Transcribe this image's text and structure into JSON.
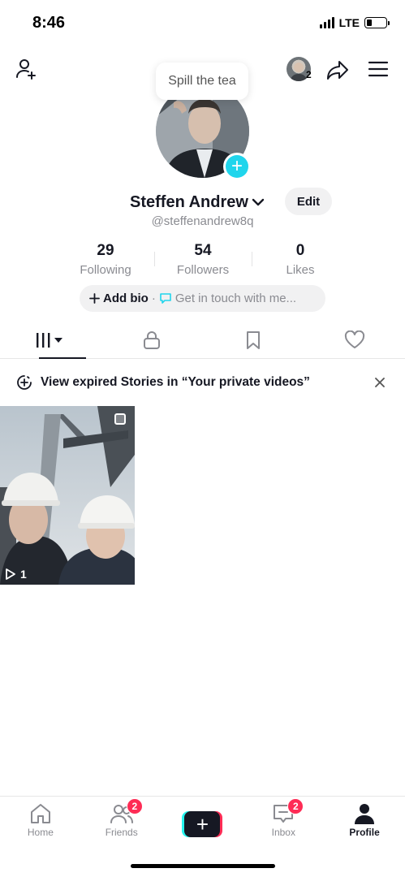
{
  "status_bar": {
    "time": "8:46",
    "network": "LTE"
  },
  "header": {
    "story_count": "2",
    "tooltip": "Spill the tea"
  },
  "profile": {
    "display_name": "Steffen Andrew",
    "username": "@steffenandrew8q",
    "edit_label": "Edit"
  },
  "stats": [
    {
      "value": "29",
      "label": "Following"
    },
    {
      "value": "54",
      "label": "Followers"
    },
    {
      "value": "0",
      "label": "Likes"
    }
  ],
  "bio": {
    "add_label": "Add bio",
    "separator": "·",
    "contact_label": "Get in touch with me..."
  },
  "banner": {
    "text": "View expired Stories in “Your private videos”"
  },
  "videos": [
    {
      "views": "1"
    }
  ],
  "bottom_nav": [
    {
      "label": "Home"
    },
    {
      "label": "Friends",
      "badge": "2"
    },
    {
      "label": ""
    },
    {
      "label": "Inbox",
      "badge": "2"
    },
    {
      "label": "Profile"
    }
  ],
  "colors": {
    "accent_cyan": "#20d5ec",
    "badge_red": "#fe2c55",
    "text_dark": "#161823",
    "text_muted": "#8a8b91"
  }
}
